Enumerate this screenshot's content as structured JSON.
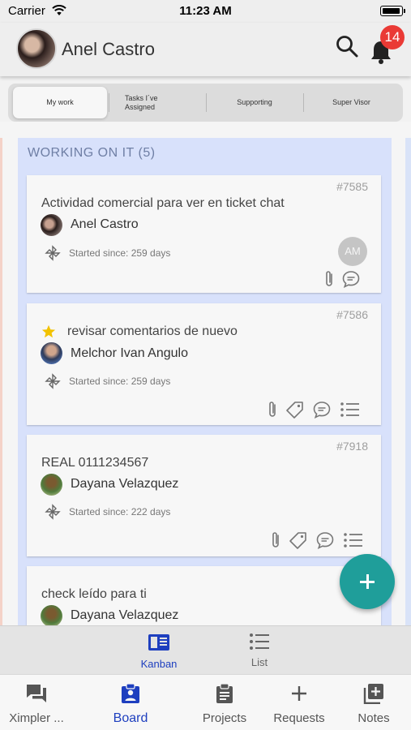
{
  "status_bar": {
    "carrier": "Carrier",
    "time": "11:23 AM"
  },
  "header": {
    "user_name": "Anel Castro",
    "notification_count": "14"
  },
  "tabs": [
    {
      "label": "My work",
      "active": true
    },
    {
      "label": "Tasks I´ve Assigned",
      "active": false
    },
    {
      "label": "Supporting",
      "active": false
    },
    {
      "label": "Super Visor",
      "active": false
    }
  ],
  "column": {
    "title": "WORKING ON IT (5)",
    "cards": [
      {
        "id": "#7585",
        "title": "Actividad comercial para ver en ticket chat",
        "assignee": "Anel Castro",
        "started": "Started since: 259 days",
        "extra_avatar": "AM",
        "starred": false
      },
      {
        "id": "#7586",
        "title": "revisar comentarios de nuevo",
        "assignee": "Melchor Ivan Angulo",
        "started": "Started since: 259 days",
        "starred": true
      },
      {
        "id": "#7918",
        "title": "REAL 0111234567",
        "assignee": "Dayana Velazquez",
        "started": "Started since: 222 days",
        "starred": false
      },
      {
        "id": "#7",
        "title": "check leído para ti",
        "assignee": "Dayana Velazquez",
        "starred": false
      }
    ]
  },
  "view_switch": [
    {
      "label": "Kanban",
      "icon": "kanban-icon",
      "active": true
    },
    {
      "label": "List",
      "icon": "list-icon",
      "active": false
    }
  ],
  "bottom_nav": [
    {
      "label": "Ximpler ...",
      "icon": "chat-icon"
    },
    {
      "label": "Board",
      "icon": "board-icon",
      "active": true
    },
    {
      "label": "Projects",
      "icon": "clipboard-icon"
    },
    {
      "label": "Requests",
      "icon": "plus-icon"
    },
    {
      "label": "Notes",
      "icon": "notes-icon"
    }
  ],
  "colors": {
    "accent": "#1e3fbf",
    "fab": "#1f9e9a",
    "badge": "#ea3a35",
    "column_bg": "#d8e1fb"
  }
}
